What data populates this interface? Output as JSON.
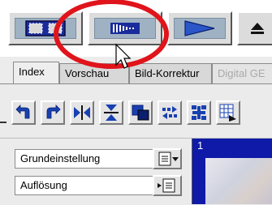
{
  "toolbar": {
    "buttons": [
      {
        "name": "select-frames-button",
        "icon": "frame-select-icon"
      },
      {
        "name": "gradient-button",
        "icon": "gradient-ramp-icon"
      },
      {
        "name": "play-button",
        "icon": "play-icon"
      },
      {
        "name": "eject-button",
        "icon": "eject-icon"
      }
    ]
  },
  "tabs": [
    {
      "label": "Index",
      "state": "active"
    },
    {
      "label": "Vorschau",
      "state": "normal"
    },
    {
      "label": "Bild-Korrektur",
      "state": "normal"
    },
    {
      "label": "Digital GE",
      "state": "disabled"
    }
  ],
  "image_tools": [
    {
      "icon": "rotate-left-icon"
    },
    {
      "icon": "rotate-right-icon"
    },
    {
      "icon": "flip-horizontal-icon"
    },
    {
      "icon": "flip-vertical-icon"
    },
    {
      "icon": "overlap-frames-icon"
    },
    {
      "icon": "swap-arrows-icon"
    },
    {
      "icon": "frame-grid-icon"
    },
    {
      "icon": "grid-arrow-icon"
    }
  ],
  "settings": {
    "preset_label": "Grundeinstellung",
    "resolution_label": "Auflösung"
  },
  "preview": {
    "frame_number": "1"
  },
  "colors": {
    "annotation_ring": "#e0141b",
    "frame_blue": "#0f1aa8",
    "icon_blue": "#1840b0"
  }
}
